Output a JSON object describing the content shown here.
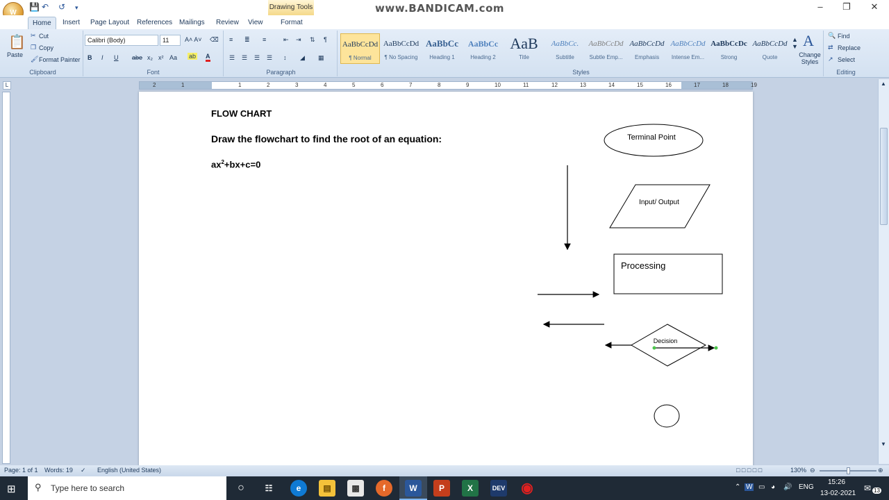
{
  "watermark": "www.BANDICAM.com",
  "context_tab_group": "Drawing Tools",
  "tabs": [
    "Home",
    "Insert",
    "Page Layout",
    "References",
    "Mailings",
    "Review",
    "View",
    "Format"
  ],
  "clipboard": {
    "paste": "Paste",
    "cut": "Cut",
    "copy": "Copy",
    "format_painter": "Format Painter",
    "label": "Clipboard"
  },
  "font": {
    "name": "Calibri (Body)",
    "size": "11",
    "label": "Font"
  },
  "paragraph": {
    "label": "Paragraph"
  },
  "styles": {
    "label": "Styles",
    "items": [
      {
        "sample": "AaBbCcDd",
        "name": "¶ Normal"
      },
      {
        "sample": "AaBbCcDd",
        "name": "¶ No Spacing"
      },
      {
        "sample": "AaBbCc",
        "name": "Heading 1"
      },
      {
        "sample": "AaBbCc",
        "name": "Heading 2"
      },
      {
        "sample": "AaB",
        "name": "Title"
      },
      {
        "sample": "AaBbCc.",
        "name": "Subtitle"
      },
      {
        "sample": "AaBbCcDd",
        "name": "Subtle Emp..."
      },
      {
        "sample": "AaBbCcDd",
        "name": "Emphasis"
      },
      {
        "sample": "AaBbCcDd",
        "name": "Intense Em..."
      },
      {
        "sample": "AaBbCcDc",
        "name": "Strong"
      },
      {
        "sample": "AaBbCcDd",
        "name": "Quote"
      }
    ],
    "change_styles": "Change Styles"
  },
  "editing": {
    "find": "Find",
    "replace": "Replace",
    "select": "Select",
    "label": "Editing"
  },
  "ruler_ticks": [
    "2",
    "1",
    "1",
    "2",
    "3",
    "4",
    "5",
    "6",
    "7",
    "8",
    "9",
    "10",
    "11",
    "12",
    "13",
    "14",
    "15",
    "16",
    "17",
    "18",
    "19"
  ],
  "document": {
    "heading": "FLOW CHART",
    "instruction": "Draw the flowchart to find the root of an equation:",
    "equation_base": "ax",
    "equation_sup": "2",
    "equation_rest": "+bx+c=0",
    "shapes": {
      "terminal": "Terminal Point",
      "io": "Input/ Output",
      "processing": "Processing",
      "decision": "Decision"
    }
  },
  "status": {
    "page": "Page: 1 of 1",
    "words": "Words: 19",
    "language": "English (United States)",
    "zoom": "130%"
  },
  "taskbar": {
    "search_placeholder": "Type here to search",
    "lang": "ENG",
    "time": "15:26",
    "date": "13-02-2021",
    "notifications": "13"
  }
}
